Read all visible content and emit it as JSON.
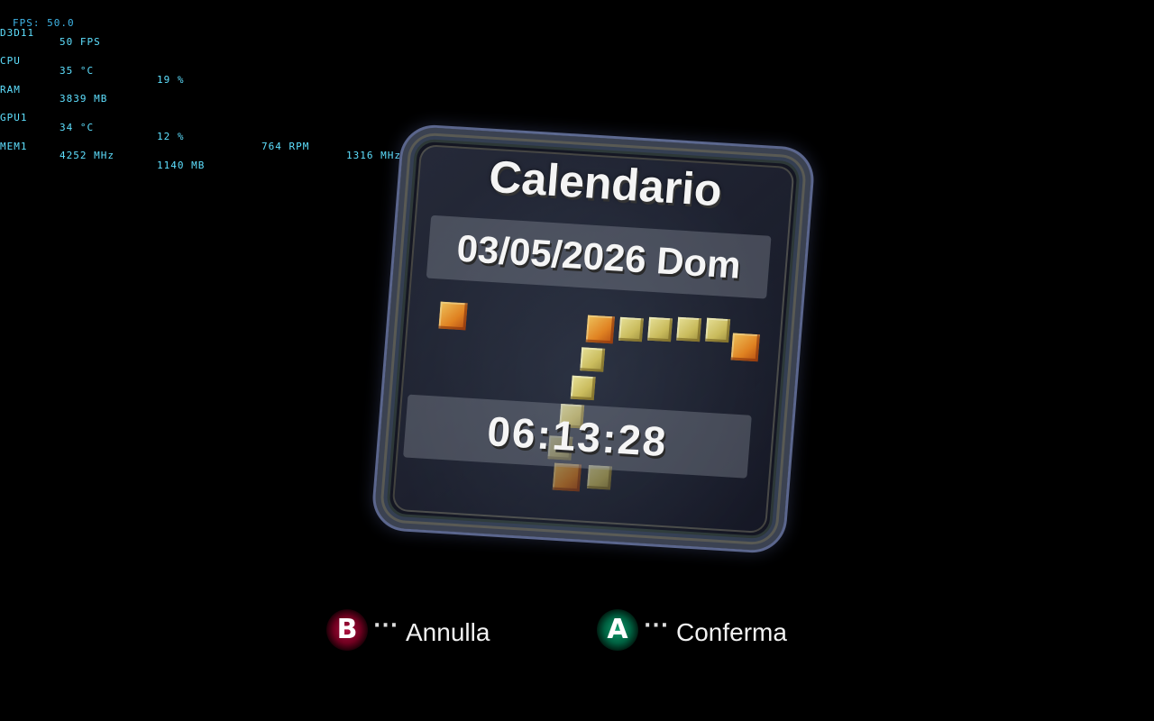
{
  "osd": {
    "rows": [
      {
        "c1": "D3D11",
        "c2": "50 FPS",
        "c3": "",
        "c4": "",
        "c5": ""
      },
      {
        "c1": "CPU",
        "c2": "35 °C",
        "c3": "19 %",
        "c4": "",
        "c5": ""
      },
      {
        "c1": "RAM",
        "c2": "3839 MB",
        "c3": "",
        "c4": "",
        "c5": ""
      },
      {
        "c1": "GPU1",
        "c2": "34 °C",
        "c3": "12 %",
        "c4": "764 RPM",
        "c5": "1316 MHz"
      },
      {
        "c1": "MEM1",
        "c2": "4252 MHz",
        "c3": "1140 MB",
        "c4": "",
        "c5": ""
      }
    ],
    "fps_overlay": "FPS: 50.0"
  },
  "calendar": {
    "title": "Calendario",
    "date": "03/05/2026 Dom",
    "time": "06:13:28"
  },
  "hints": {
    "cancel_button": "B",
    "cancel_dots": "···",
    "cancel_label": "Annulla",
    "confirm_button": "A",
    "confirm_dots": "···",
    "confirm_label": "Conferma",
    "cancel_color": "#b01040",
    "confirm_color": "#10a070"
  }
}
